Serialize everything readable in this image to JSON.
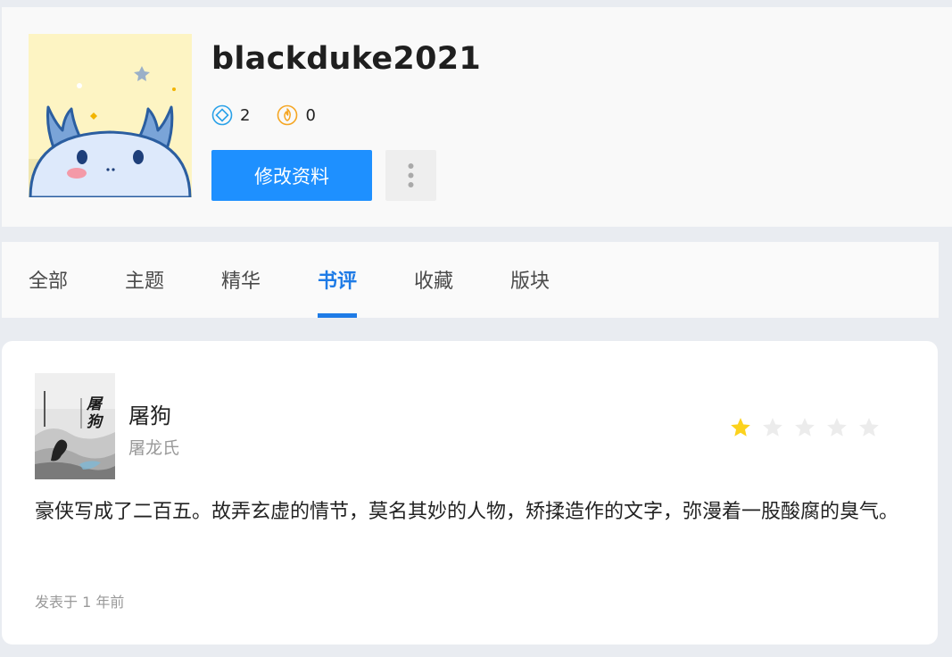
{
  "profile": {
    "username": "blackduke2021",
    "stat_points": "2",
    "stat_coins": "0",
    "edit_button": "修改资料",
    "avatar_icon": "dragon-mascot-avatar"
  },
  "tabs": [
    {
      "label": "全部"
    },
    {
      "label": "主题"
    },
    {
      "label": "精华"
    },
    {
      "label": "书评"
    },
    {
      "label": "收藏"
    },
    {
      "label": "版块"
    }
  ],
  "active_tab": "书评",
  "review": {
    "book_title": "屠狗",
    "book_author": "屠龙氏",
    "cover_text": "屠狗",
    "rating": 1,
    "rating_max": 5,
    "text": "豪侠写成了二百五。故弄玄虚的情节，莫名其妙的人物，矫揉造作的文字，弥漫着一股酸腐的臭气。",
    "posted": "发表于 1 年前"
  },
  "colors": {
    "accent": "#1e7be6",
    "button": "#1e90ff",
    "star_active": "#fcd21d",
    "star_inactive": "#ececec"
  }
}
